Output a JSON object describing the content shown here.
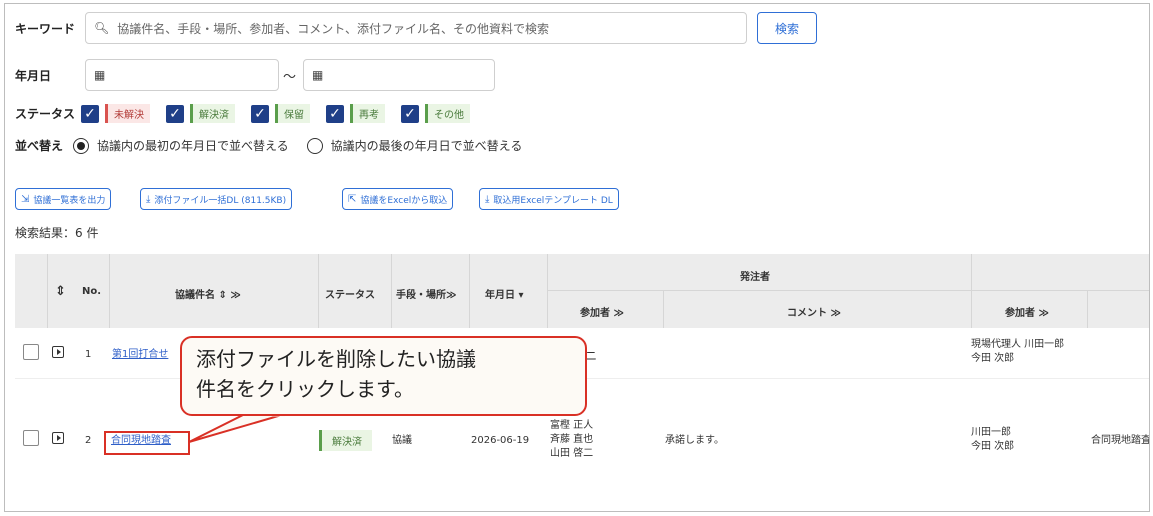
{
  "search": {
    "keyword_label": "キーワード",
    "keyword_placeholder": "協議件名、手段・場所、参加者、コメント、添付ファイル名、その他資料で検索",
    "search_button": "検索",
    "date_label": "年月日",
    "date_separator": "～",
    "status_label": "ステータス",
    "statuses": [
      "未解決",
      "解決済",
      "保留",
      "再考",
      "その他"
    ],
    "sort_label": "並べ替え",
    "sort_options": [
      "協議内の最初の年月日で並べ替える",
      "協議内の最後の年月日で並べ替える"
    ]
  },
  "toolbar": {
    "export_list": "協議一覧表を出力",
    "download_attachments": "添付ファイル一括DL (811.5KB)",
    "import_excel": "協議をExcelから取込",
    "download_template": "取込用Excelテンプレート DL"
  },
  "results": {
    "summary": "検索結果：6 件"
  },
  "table": {
    "headers": {
      "no": "No.",
      "title": "協議件名 ⇕ ≫",
      "status": "ステータス",
      "method": "手段・場所≫",
      "date": "年月日 ▾",
      "orderer_group": "発注者",
      "orderer_participants": "参加者 ≫",
      "orderer_comment": "コメント ≫",
      "contractor_participants": "参加者 ≫"
    },
    "rows": [
      {
        "no": "1",
        "title": "第1回打合せ",
        "orderer_participants_tail": "ニ",
        "contractor_participants": [
          "現場代理人 川田一郎",
          "今田 次郎"
        ]
      },
      {
        "no": "2",
        "title": "合同現地踏査",
        "status": "解決済",
        "method": "協議",
        "date": "2026-06-19",
        "orderer_participants": [
          "富樫 正人",
          "斉藤 直也",
          "山田 啓二"
        ],
        "orderer_comment": "承諾します。",
        "contractor_participants": [
          "川田一郎",
          "今田 次郎"
        ],
        "next_col": "合同現地踏査"
      }
    ]
  },
  "callout": {
    "line1": "添付ファイルを削除したい協議",
    "line2": "件名をクリックします。"
  },
  "colors": {
    "accent": "#2f6fd6",
    "callout_border": "#d93025",
    "checkbox": "#1f3f88"
  }
}
